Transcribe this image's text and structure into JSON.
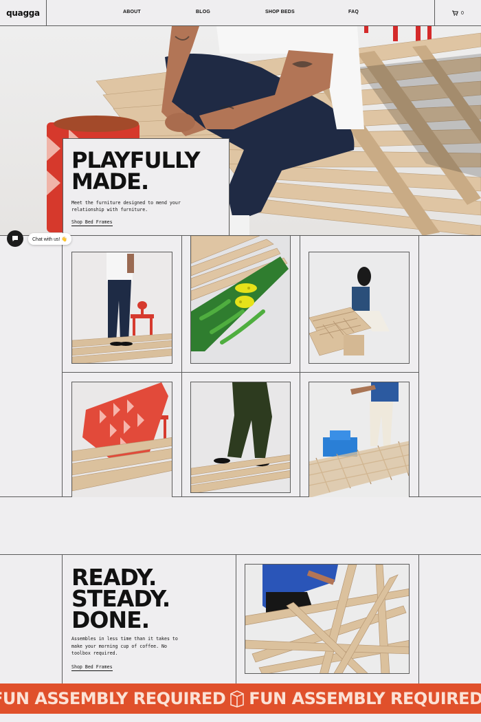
{
  "header": {
    "logo": "quagga",
    "nav": [
      "ABOUT",
      "BLOG",
      "SHOP BEDS",
      "FAQ"
    ],
    "cart_count": "0"
  },
  "hero": {
    "title_line1": "PLAYFULLY",
    "title_line2": "MADE.",
    "description": "Meet the furniture designed to mend your relationship with furniture.",
    "link": "Shop Bed Frames"
  },
  "chat": {
    "label": "Chat with us! 👋"
  },
  "ready": {
    "title_line1": "READY.",
    "title_line2": "STEADY.",
    "title_line3": "DONE.",
    "description": "Assembles in less time than it takes to make your morning cup of coffee. No toolbox required.",
    "link": "Shop Bed Frames"
  },
  "marquee": {
    "text": "FUN ASSEMBLY REQUIRED"
  },
  "colors": {
    "accent": "#e0502b",
    "background": "#efeef0",
    "wood": "#dcc3a1"
  },
  "icons": {
    "cart": "cart-icon",
    "chat": "chat-icon",
    "box": "box-icon"
  }
}
